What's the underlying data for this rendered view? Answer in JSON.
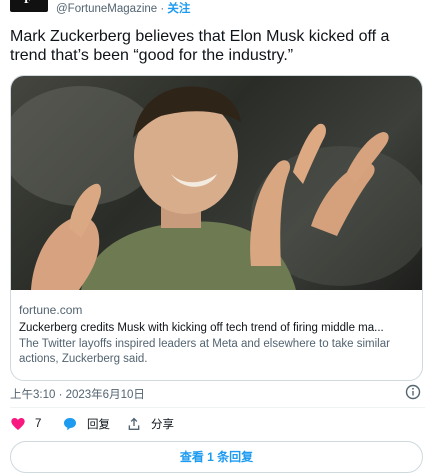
{
  "author": {
    "handle": "@FortuneMagazine",
    "separator": "·",
    "follow_label": "关注",
    "avatar_letter": "F"
  },
  "tweet": {
    "text": "Mark Zuckerberg believes that Elon Musk kicked off a trend that’s been “good for the industry.”",
    "timestamp": "上午3:10 · 2023年6月10日"
  },
  "card": {
    "domain": "fortune.com",
    "title": "Zuckerberg credits Musk with kicking off tech trend of firing middle ma...",
    "description": "The Twitter layoffs inspired leaders at Meta and elsewhere to take similar actions, Zuckerberg said."
  },
  "actions": {
    "like_count": "7",
    "reply_label": "回复",
    "share_label": "分享"
  },
  "more_replies_label": "查看 1 条回复",
  "colors": {
    "accent": "#1d9bf0",
    "like": "#f91880",
    "text": "#0f1419",
    "secondary": "#536471",
    "border": "#cfd9de"
  },
  "icons": [
    "heart-icon",
    "reply-bubble-icon",
    "share-icon",
    "info-icon"
  ]
}
